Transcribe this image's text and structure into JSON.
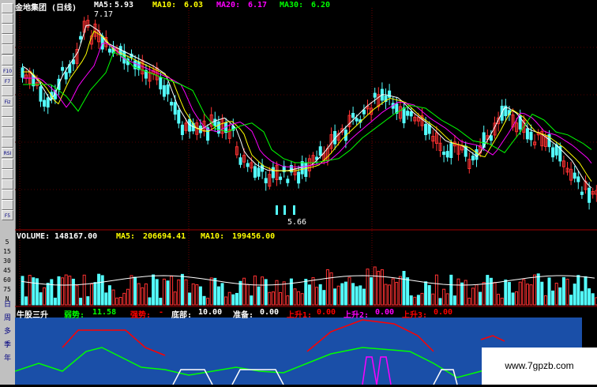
{
  "toolbar": {
    "icons": [
      "cursor-icon",
      "magnify-icon",
      "zoom-out-icon",
      "chart-type-icon",
      "line-chart-icon",
      "indicator-icon",
      "f10-icon",
      "f7-icon",
      "grid-icon",
      "fiz-icon",
      "volume-icon",
      "macd-icon",
      "kdj-icon",
      "candle-icon",
      "rsi-icon",
      "arrow-up-icon",
      "arrow-right-icon",
      "arrow-left-icon",
      "arrow-down-icon",
      "refresh-icon",
      "f5-icon"
    ],
    "labels": [
      "",
      "",
      "",
      "",
      "",
      "",
      "F10",
      "F7",
      "",
      "Fiz",
      "",
      "",
      "",
      "",
      "RSI",
      "",
      "",
      "",
      "",
      "",
      "F5"
    ]
  },
  "yaxis": {
    "ticks": [
      "5",
      "15",
      "30",
      "45",
      "60",
      "75",
      "N"
    ]
  },
  "side_labels": [
    "日",
    "周",
    "多",
    "季",
    "年"
  ],
  "price_header": {
    "name": "金地集团 (日线)",
    "ma5_label": "MA5:",
    "ma5": "5.93",
    "ma10_label": "MA10:",
    "ma10": "6.03",
    "ma20_label": "MA20:",
    "ma20": "6.17",
    "ma30_label": "MA30:",
    "ma30": "6.20",
    "high_label": "7.17",
    "low_label": "5.66"
  },
  "volume_header": {
    "volume_label": "VOLUME:",
    "volume": "148167.00",
    "ma5_label": "MA5:",
    "ma5": "206694.41",
    "ma10_label": "MA10:",
    "ma10": "199456.00"
  },
  "indicator_header": {
    "name": "牛股三升",
    "weak_label": "弱势:",
    "weak": "11.58",
    "strong_label": "强势:",
    "strong": "-",
    "bottom_label": "底部:",
    "bottom": "10.00",
    "prep_label": "准备:",
    "prep": "0.00",
    "rise1_label": "上升1:",
    "rise1": "0.00",
    "rise2_label": "上升2:",
    "rise2": "0.00",
    "rise3_label": "上升3:",
    "rise3": "0.00"
  },
  "watermark": "www.7gpzb.com",
  "colors": {
    "up": "#ff3232",
    "down": "#54ffff",
    "ma5": "#ffffff",
    "ma10": "#ffff00",
    "ma20": "#ff00ff",
    "ma30": "#00ff00",
    "indicator_bg": "#1a4fa8",
    "weak": "#00ff00",
    "strong": "#ff0000",
    "bottom": "#ffffff",
    "prep": "#ff00ff",
    "rise1": "#ff0000"
  }
}
